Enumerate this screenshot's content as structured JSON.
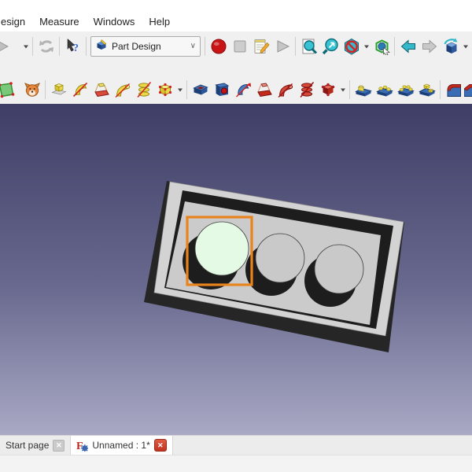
{
  "menu": {
    "items": [
      {
        "label": "esign",
        "name": "menu-item-design"
      },
      {
        "label": "Measure",
        "name": "menu-item-measure"
      },
      {
        "label": "Windows",
        "name": "menu-item-windows"
      },
      {
        "label": "Help",
        "name": "menu-item-help"
      }
    ]
  },
  "workbench_selector": {
    "value": "Part Design",
    "icon": "workbench-partdesign-icon",
    "chevron": "∨"
  },
  "toolbars": {
    "row1": [
      {
        "type": "buttons",
        "items": [
          {
            "icon": "redo-arrow-icon",
            "name": "redo-button",
            "cut": true,
            "disabled": true
          },
          {
            "icon": "caret-down-icon",
            "name": "redo-dropdown-caret",
            "caret": true
          }
        ]
      },
      {
        "type": "buttons",
        "items": [
          {
            "icon": "refresh-icon",
            "name": "refresh-button",
            "disabled": true
          }
        ]
      },
      {
        "type": "buttons",
        "items": [
          {
            "icon": "whats-this-icon",
            "name": "whats-this-button"
          }
        ]
      },
      {
        "type": "combo",
        "name": "workbench-selector"
      },
      {
        "type": "buttons",
        "items": [
          {
            "icon": "record-macro-icon",
            "name": "macro-record-button"
          },
          {
            "icon": "stop-macro-icon",
            "name": "macro-stop-button",
            "disabled": true
          },
          {
            "icon": "edit-macro-icon",
            "name": "macro-edit-button"
          },
          {
            "icon": "play-macro-icon",
            "name": "macro-play-button",
            "disabled": true
          }
        ]
      },
      {
        "type": "buttons",
        "items": [
          {
            "icon": "fit-all-icon",
            "name": "fit-all-button"
          },
          {
            "icon": "zoom-selection-icon",
            "name": "zoom-selection-button"
          },
          {
            "icon": "draw-style-icon",
            "name": "draw-style-button"
          },
          {
            "icon": "caret-down-icon",
            "name": "draw-style-caret",
            "caret": true
          },
          {
            "icon": "box-element-selection-icon",
            "name": "box-element-selection-button"
          }
        ]
      },
      {
        "type": "buttons",
        "items": [
          {
            "icon": "back-arrow-icon",
            "name": "navigate-back-button"
          },
          {
            "icon": "forward-arrow-icon",
            "name": "navigate-forward-button",
            "disabled": true
          },
          {
            "icon": "axonometric-cube-icon",
            "name": "axonometric-view-button"
          },
          {
            "icon": "caret-down-icon",
            "name": "axonometric-view-caret",
            "caret": true
          }
        ]
      },
      {
        "type": "buttons",
        "items": [
          {
            "icon": "zoom-fit-icon",
            "name": "active-view-button",
            "highlight": true,
            "cut": true
          }
        ]
      }
    ],
    "row2": [
      {
        "type": "buttons",
        "items": [
          {
            "icon": "create-sketch-icon",
            "name": "create-sketch-button",
            "cut": true
          },
          {
            "icon": "dog-face-icon",
            "name": "dog-face-button"
          }
        ]
      },
      {
        "type": "buttons",
        "items": [
          {
            "icon": "pad-icon",
            "name": "pad-button"
          },
          {
            "icon": "revolution-icon",
            "name": "revolution-button"
          },
          {
            "icon": "additive-loft-icon",
            "name": "additive-loft-button"
          },
          {
            "icon": "additive-pipe-icon",
            "name": "additive-pipe-button"
          },
          {
            "icon": "additive-helix-icon",
            "name": "additive-helix-button"
          },
          {
            "icon": "additive-box-icon",
            "name": "additive-primitive-button"
          },
          {
            "icon": "caret-down-icon",
            "name": "additive-primitive-caret",
            "caret": true
          }
        ]
      },
      {
        "type": "buttons",
        "items": [
          {
            "icon": "pocket-icon",
            "name": "pocket-button"
          },
          {
            "icon": "hole-icon",
            "name": "hole-button"
          },
          {
            "icon": "groove-icon",
            "name": "groove-button"
          },
          {
            "icon": "subtractive-loft-icon",
            "name": "subtractive-loft-button"
          },
          {
            "icon": "subtractive-pipe-icon",
            "name": "subtractive-pipe-button"
          },
          {
            "icon": "subtractive-helix-icon",
            "name": "subtractive-helix-button"
          },
          {
            "icon": "subtractive-box-icon",
            "name": "subtractive-primitive-button"
          },
          {
            "icon": "caret-down-icon",
            "name": "subtractive-primitive-caret",
            "caret": true
          }
        ]
      },
      {
        "type": "buttons",
        "items": [
          {
            "icon": "mirrored-icon",
            "name": "mirrored-button"
          },
          {
            "icon": "linear-pattern-icon",
            "name": "linear-pattern-button"
          },
          {
            "icon": "polar-pattern-icon",
            "name": "polar-pattern-button"
          },
          {
            "icon": "multitransform-icon",
            "name": "multitransform-button"
          }
        ]
      },
      {
        "type": "buttons",
        "items": [
          {
            "icon": "fillet-icon",
            "name": "fillet-button"
          },
          {
            "icon": "chamfer-icon",
            "name": "chamfer-button",
            "cut": true
          }
        ]
      }
    ]
  },
  "viewport": {
    "bg_top": "#3e3e66",
    "bg_bottom": "#a9a9c5",
    "model_description": "gray rectangular plate with recessed pocket and three circular holes, viewed in axonometric projection",
    "face_color": "#d3d3d3",
    "floor_color": "#cbcbcb",
    "side_color": "#262626",
    "pocket_color": "#1d1d1d",
    "hole_top_color": "#c9c9c9",
    "selected_face_color": "#e4fae4",
    "selection_box_color": "#e8831d"
  },
  "tabs": [
    {
      "label": "Start page",
      "active": false,
      "close_glyph": "✕"
    },
    {
      "label": "Unnamed : 1*",
      "active": true,
      "close_glyph": "✕"
    }
  ]
}
